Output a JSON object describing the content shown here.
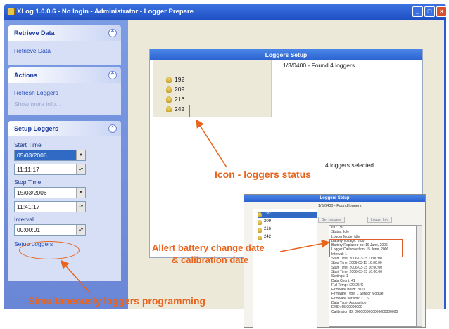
{
  "window": {
    "title": "XLog 1.0.0.6 - No login - Administrator - Logger Prepare",
    "min_label": "_",
    "max_label": "□",
    "close_label": "×"
  },
  "sidebar": {
    "retrieve": {
      "title": "Retrieve Data",
      "link": "Retrieve Data"
    },
    "actions": {
      "title": "Actions",
      "refresh": "Refresh Loggers",
      "show_more": "Show more info..."
    },
    "setup": {
      "title": "Setup Loggers",
      "start_time_label": "Start Time",
      "start_date": "05/03/2006",
      "start_time": "11:11:17",
      "stop_time_label": "Stop Time",
      "stop_date": "15/03/2006",
      "stop_time": "11:41:17",
      "interval_label": "Interval",
      "interval": "00:00:01",
      "setup_link": "Setup Loggers"
    }
  },
  "loggers_setup": {
    "title": "Loggers Setup",
    "status": "1/3/0400 - Found 4 loggers",
    "loggers": [
      "192",
      "209",
      "216",
      "242"
    ],
    "selected_text": "4 loggers selected"
  },
  "loggers_setup_small": {
    "title": "Loggers Setup",
    "status": "1/3/0400 - Found loggers",
    "loggers": [
      "192",
      "209",
      "216",
      "242"
    ],
    "buttons": [
      "Get Loggers",
      "Logger Info"
    ],
    "properties": [
      "ID : 192",
      "Status: Idle",
      "Logger Mode: Idle",
      "Battery Voltage: 3.06",
      "Battery Replaced on: 19 June, 2006",
      "Logger Calibrated on: 15 June, 2006",
      "Interval: 1",
      "Start Time: 2006-03-15 11:00:00",
      "Stop Time: 2006-03-15 16:00:00",
      "Start Time: 2006-03-15 16:00:00",
      "Start Time: 2006-03-15 16:00:00",
      "Settings: 1",
      "Data Count: 41",
      "Full Temp: +20.25°C",
      "Firmware Build: 2010",
      "Firmware Type: 1 Sensor Module",
      "Firmware Version: 1.1.6",
      "Data Type: Acquisition",
      "EXID: 65 00000000",
      "Calibration ID: 0000000000000000000000"
    ]
  },
  "annotations": {
    "icon_status": "Icon - loggers status",
    "alert_line1": "Allert battery change date",
    "alert_line2": "& calibration date",
    "programming": "Simultaneously loggers programming"
  }
}
